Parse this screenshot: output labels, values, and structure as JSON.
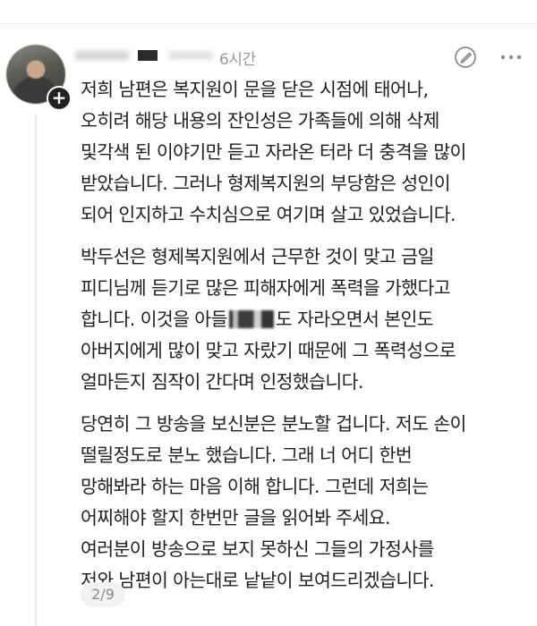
{
  "post": {
    "time_ago": "6시간",
    "paragraphs": [
      {
        "lines": [
          "저희 남편은 복지원이 문을 닫은 시점에 태어나,",
          "오히려 해당 내용의 잔인성은 가족들에 의해 삭제",
          "및각색 된 이야기만 듣고 자라온 터라 더 충격을 많이",
          "받았습니다. 그러나 형제복지원의 부당함은 성인이",
          "되어 인지하고 수치심으로 여기며 살고 있었습니다."
        ]
      },
      {
        "lines": [
          "박두선은 형제복지원에서 근무한 것이 맞고 금일",
          "피디님께 듣기로 많은 피해자에게 폭력을 가했다고",
          "합니다. 이것을 아들",
          "도 자라오면서 본인도",
          "아버지에게 많이 맞고 자랐기 때문에 그 폭력성으로",
          "얼마든지 짐작이 간다며 인정했습니다."
        ]
      },
      {
        "lines": [
          "당연히 그 방송을 보신분은 분노할 겁니다. 저도 손이",
          "떨릴정도로 분노 했습니다. 그래 너 어디 한번",
          "망해봐라 하는 마음 이해 합니다. 그런데 저희는",
          "어찌해야 할지 한번만 글을 읽어봐 주세요.",
          "여러분이 방송으로 보지 못하신 그들의 가정사를",
          "저와 남편이 아는대로 낱낱이 보여드리겠습니다."
        ]
      }
    ],
    "page_indicator": "2/9"
  },
  "icons": {
    "avatar_add": "plus-icon",
    "edit": "edit-icon",
    "more": "more-icon"
  }
}
